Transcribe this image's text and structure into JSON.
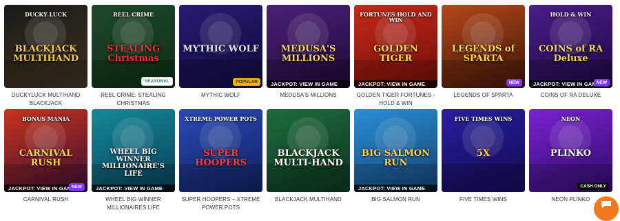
{
  "games": [
    {
      "name": "DUCKYLUCK MULTIHAND BLACKJACK",
      "art_title": "BLACKJACK MULTIHAND",
      "art_logo": "DUCKY LUCK",
      "jackpot": "",
      "badge": "",
      "colors": [
        "#1b1b1b",
        "#3b3320"
      ],
      "title_color": "#f2c94c",
      "icon": "playing-cards-icon"
    },
    {
      "name": "REEL CRIME: STEALING CHRISTMAS",
      "art_title": "STEALING Christmas",
      "art_logo": "REEL CRIME",
      "jackpot": "",
      "badge": "SEASONAL",
      "colors": [
        "#1d4a2a",
        "#0f2b18"
      ],
      "title_color": "#e8323c",
      "icon": "christmas-thief-icon"
    },
    {
      "name": "MYTHIC WOLF",
      "art_title": "MYTHIC WOLF",
      "art_logo": "",
      "jackpot": "",
      "badge": "POPULAR",
      "colors": [
        "#2a1b74",
        "#0f0a3a"
      ],
      "title_color": "#dfe3ff",
      "icon": "wolf-icon"
    },
    {
      "name": "MEDUSA'S MILLIONS",
      "art_title": "MEDUSA'S MILLIONS",
      "art_logo": "",
      "jackpot": "JACKPOT: VIEW IN GAME",
      "badge": "",
      "colors": [
        "#4c1f7a",
        "#1d0b33"
      ],
      "title_color": "#f4d35e",
      "icon": "medusa-icon"
    },
    {
      "name": "GOLDEN TIGER FORTUNES - HOLD & WIN",
      "art_title": "GOLDEN TIGER",
      "art_logo": "FORTUNES HOLD AND WIN",
      "jackpot": "JACKPOT: VIEW IN GAME",
      "badge": "",
      "colors": [
        "#c62a1a",
        "#6e0e08"
      ],
      "title_color": "#ffd84a",
      "icon": "tiger-icon"
    },
    {
      "name": "LEGENDS OF SPARTA",
      "art_title": "LEGENDS of SPARTA",
      "art_logo": "",
      "jackpot": "",
      "badge": "NEW",
      "colors": [
        "#b5481a",
        "#3d1508"
      ],
      "title_color": "#ffd84a",
      "icon": "spartan-icon"
    },
    {
      "name": "COINS OF RA DELUXE",
      "art_title": "COINS of RA Deluxe",
      "art_logo": "HOLD & WIN",
      "jackpot": "JACKPOT: VIEW IN GAME",
      "badge": "NEW",
      "colors": [
        "#4b1c8a",
        "#1b0b40"
      ],
      "title_color": "#f4d35e",
      "icon": "coin-icon"
    },
    {
      "name": "CARNIVAL RUSH",
      "art_title": "CARNIVAL RUSH",
      "art_logo": "BONUS MANIA",
      "jackpot": "JACKPOT: VIEW IN GAME",
      "badge": "NEW",
      "colors": [
        "#c8341c",
        "#3a0e33"
      ],
      "title_color": "#ffd84a",
      "icon": "carnival-icon"
    },
    {
      "name": "WHEEL BIG WINNER MILLIONAIRES LIFE",
      "art_title": "WHEEL BIG WINNER MILLIONAIRE'S LIFE",
      "art_logo": "",
      "jackpot": "JACKPOT: VIEW IN GAME",
      "badge": "",
      "colors": [
        "#148a9a",
        "#0b3d57"
      ],
      "title_color": "#ffffff",
      "icon": "prize-wheel-icon"
    },
    {
      "name": "SUPER HOOPERS – XTREME POWER POTS",
      "art_title": "SUPER HOOPERS",
      "art_logo": "XTREME POWER POTS",
      "jackpot": "",
      "badge": "",
      "colors": [
        "#2a4ab8",
        "#101f5a"
      ],
      "title_color": "#ff3b3b",
      "icon": "basketball-icon"
    },
    {
      "name": "BLACKJACK MULTIHAND",
      "art_title": "BLACKJACK MULTI-HAND",
      "art_logo": "",
      "jackpot": "",
      "badge": "",
      "colors": [
        "#1f6b3c",
        "#0b3320"
      ],
      "title_color": "#ffffff",
      "icon": "playing-cards-icon"
    },
    {
      "name": "BIG SALMON RUN",
      "art_title": "BIG SALMON RUN",
      "art_logo": "",
      "jackpot": "JACKPOT: VIEW IN GAME",
      "badge": "",
      "colors": [
        "#2a8fd6",
        "#15406e"
      ],
      "title_color": "#ffd84a",
      "icon": "fisherman-icon"
    },
    {
      "name": "FIVE TIMES WINS",
      "art_title": "5X",
      "art_logo": "FIVE TIMES WINS",
      "jackpot": "",
      "badge": "",
      "colors": [
        "#2b1fa0",
        "#120a4e"
      ],
      "title_color": "#ffd84a",
      "icon": "five-times-icon"
    },
    {
      "name": "NEON PLINKO",
      "art_title": "PLINKO",
      "art_logo": "NEON",
      "jackpot": "",
      "badge": "CASH ONLY",
      "colors": [
        "#7b22d1",
        "#2e0b66"
      ],
      "title_color": "#ffffff",
      "icon": "plinko-ball-icon"
    }
  ],
  "chat": {
    "icon": "chat-icon"
  }
}
